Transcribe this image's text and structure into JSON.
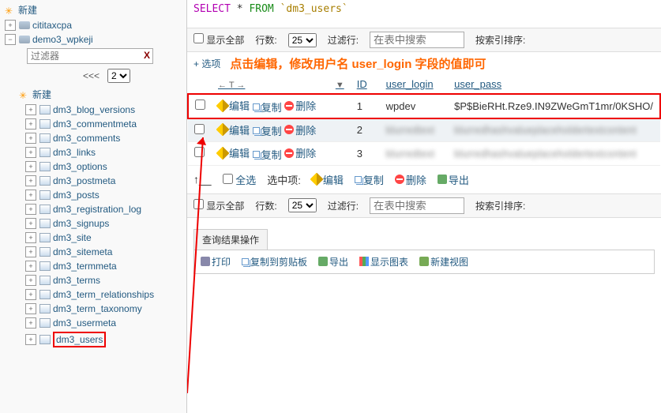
{
  "sidebar": {
    "new_label": "新建",
    "db1": "cititaxcpa",
    "db2": "demo3_wpkeji",
    "filter_placeholder": "过滤器",
    "pager_prev": "<<<",
    "pager_page": "2",
    "tables_new": "新建",
    "tables": [
      "dm3_blog_versions",
      "dm3_commentmeta",
      "dm3_comments",
      "dm3_links",
      "dm3_options",
      "dm3_postmeta",
      "dm3_posts",
      "dm3_registration_log",
      "dm3_signups",
      "dm3_site",
      "dm3_sitemeta",
      "dm3_termmeta",
      "dm3_terms",
      "dm3_term_relationships",
      "dm3_term_taxonomy",
      "dm3_usermeta",
      "dm3_users"
    ]
  },
  "sql": {
    "select": "SELECT",
    "star": "*",
    "from": "FROM",
    "table": "`dm3_users`"
  },
  "toolbar": {
    "show_all": "显示全部",
    "rows_label": "行数:",
    "rows_value": "25",
    "filter_label": "过滤行:",
    "filter_placeholder": "在表中搜索",
    "sort_label": "按索引排序:"
  },
  "options_label": "+ 选项",
  "annotation": "点击编辑，修改用户名 user_login 字段的值即可",
  "table": {
    "headers": {
      "id": "ID",
      "user_login": "user_login",
      "user_pass": "user_pass"
    },
    "actions": {
      "edit": "编辑",
      "copy": "复制",
      "delete": "删除"
    },
    "rows": [
      {
        "id": "1",
        "user_login": "wpdev",
        "user_pass": "$P$BieRHt.Rze9.IN9ZWeGmT1mr/0KSHO/"
      },
      {
        "id": "2",
        "user_login": "—",
        "user_pass": "—"
      },
      {
        "id": "3",
        "user_login": "—",
        "user_pass": "—"
      }
    ]
  },
  "footer": {
    "select_all": "全选",
    "selected_label": "选中项:",
    "edit": "编辑",
    "copy": "复制",
    "delete": "删除",
    "export": "导出"
  },
  "result_ops": {
    "title": "查询结果操作",
    "print": "打印",
    "clipboard": "复制到剪贴板",
    "export": "导出",
    "chart": "显示图表",
    "create_view": "新建视图"
  }
}
